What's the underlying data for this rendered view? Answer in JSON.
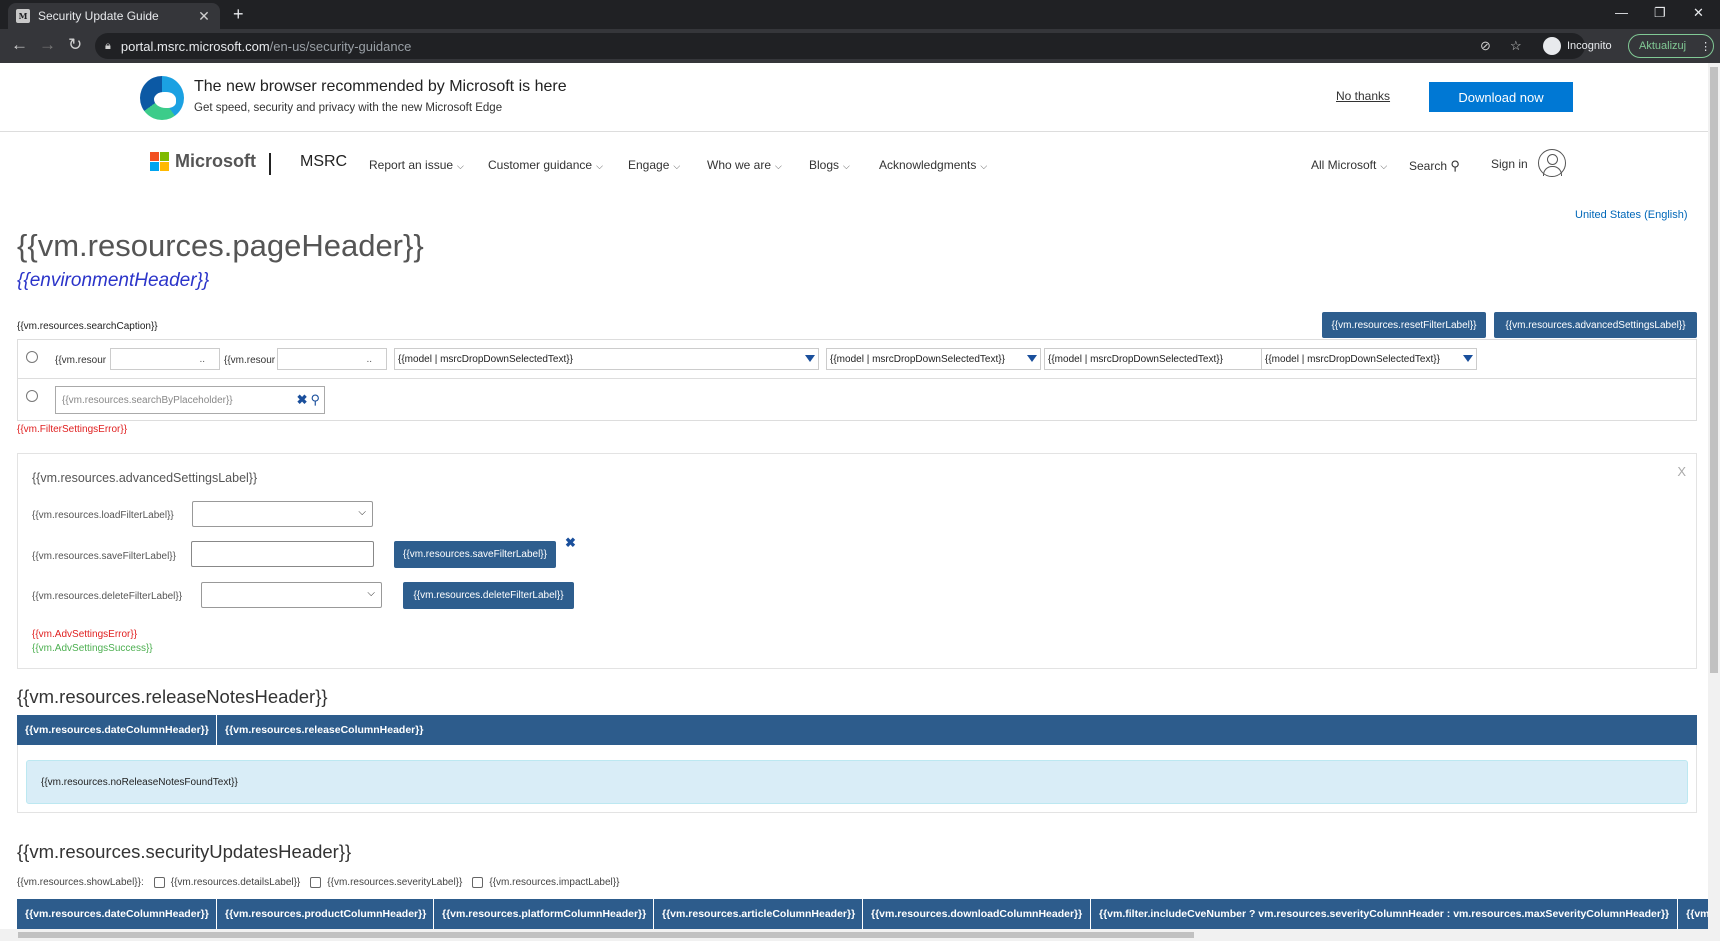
{
  "browser": {
    "tab_title": "Security Update Guide",
    "favicon_text": "M",
    "url_host": "portal.msrc.microsoft.com",
    "url_path": "/en-us/security-guidance",
    "incognito_label": "Incognito",
    "update_label": "Aktualizuj"
  },
  "banner": {
    "title": "The new browser recommended by Microsoft is here",
    "subtitle": "Get speed, security and privacy with the new Microsoft Edge",
    "no_thanks": "No thanks",
    "download": "Download now"
  },
  "header": {
    "brand": "Microsoft",
    "site": "MSRC",
    "nav": [
      {
        "label": "Report an issue"
      },
      {
        "label": "Customer guidance"
      },
      {
        "label": "Engage"
      },
      {
        "label": "Who we are"
      },
      {
        "label": "Blogs"
      },
      {
        "label": "Acknowledgments"
      }
    ],
    "all_microsoft": "All Microsoft",
    "search": "Search",
    "sign_in": "Sign in"
  },
  "locale": "United States (English)",
  "page": {
    "title": "{{vm.resources.pageHeader}}",
    "environment": "{{environmentHeader}}",
    "search_caption": "{{vm.resources.searchCaption}}",
    "reset_filter": "{{vm.resources.resetFilterLabel}}",
    "advanced_settings": "{{vm.resources.advancedSettingsLabel}}"
  },
  "filters": {
    "from_label": "{{vm.resour",
    "to_label": "{{vm.resour",
    "date_btn": "..",
    "dropdowns": [
      "{{model | msrcDropDownSelectedText}}",
      "{{model | msrcDropDownSelectedText}}",
      "{{model | msrcDropDownSelectedText}}",
      "{{model | msrcDropDownSelectedText}}"
    ],
    "search_placeholder": "{{vm.resources.searchByPlaceholder}}",
    "error": "{{vm.FilterSettingsError}}"
  },
  "advanced": {
    "title": "{{vm.resources.advancedSettingsLabel}}",
    "close": "X",
    "load_label": "{{vm.resources.loadFilterLabel}}",
    "save_label": "{{vm.resources.saveFilterLabel}}",
    "save_button": "{{vm.resources.saveFilterLabel}}",
    "delete_label": "{{vm.resources.deleteFilterLabel}}",
    "delete_button": "{{vm.resources.deleteFilterLabel}}",
    "error": "{{vm.AdvSettingsError}}",
    "success": "{{vm.AdvSettingsSuccess}}"
  },
  "release_notes": {
    "header": "{{vm.resources.releaseNotesHeader}}",
    "columns": [
      "{{vm.resources.dateColumnHeader}}",
      "{{vm.resources.releaseColumnHeader}}"
    ],
    "empty": "{{vm.resources.noReleaseNotesFoundText}}"
  },
  "security_updates": {
    "header": "{{vm.resources.securityUpdatesHeader}}",
    "show_label": "{{vm.resources.showLabel}}:",
    "show_options": [
      "{{vm.resources.detailsLabel}}",
      "{{vm.resources.severityLabel}}",
      "{{vm.resources.impactLabel}}"
    ],
    "columns": [
      "{{vm.resources.dateColumnHeader}}",
      "{{vm.resources.productColumnHeader}}",
      "{{vm.resources.platformColumnHeader}}",
      "{{vm.resources.articleColumnHeader}}",
      "{{vm.resources.downloadColumnHeader}}",
      "{{vm.filter.includeCveNumber ? vm.resources.severityColumnHeader : vm.resources.maxSeverityColumnHeader}}",
      "{{vm.fi"
    ]
  },
  "colors": {
    "table_header": "#2d5c8c",
    "button_primary": "#2e5e8e",
    "edge_download": "#0078d4",
    "error_text": "#e02020",
    "success_text": "#4caf50",
    "info_box": "#d9edf7"
  }
}
